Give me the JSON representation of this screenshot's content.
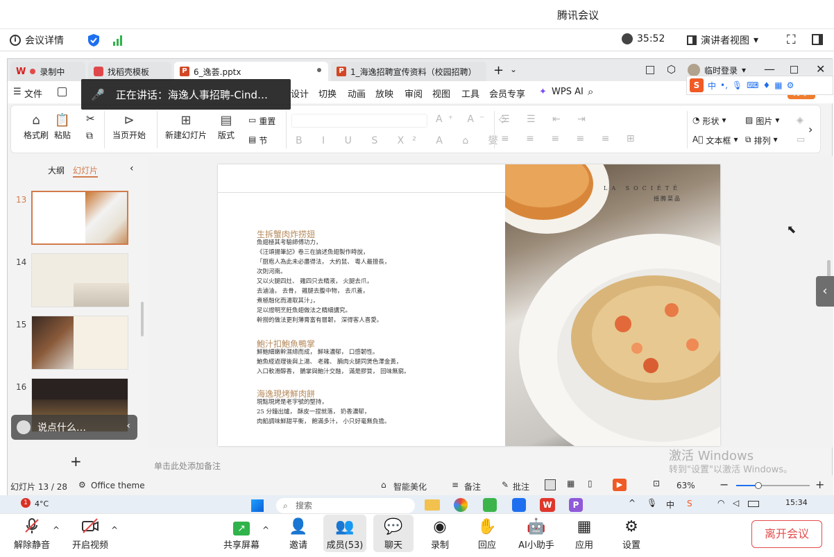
{
  "meeting": {
    "title": "腾讯会议",
    "details_label": "会议详情",
    "timer": "35:52",
    "view_label": "演讲者视图"
  },
  "wps": {
    "tabs": [
      {
        "label": "录制中"
      },
      {
        "label": "找稻壳模板"
      },
      {
        "label": "6_逸荟.pptx"
      },
      {
        "label": "1_海逸招聘宣传资料（校园招聘）.pp"
      }
    ],
    "login_label": "临时登录",
    "menu": [
      "文件",
      "设计",
      "切换",
      "动画",
      "放映",
      "审阅",
      "视图",
      "工具",
      "会员专享",
      "WPS AI"
    ],
    "share_label": "分享",
    "ribbon": {
      "format_brush": "格式刷",
      "paste": "粘贴",
      "from_current": "当页开始",
      "new_slide": "新建幻灯片",
      "layout": "版式",
      "reset": "重置",
      "section": "节",
      "shape": "形状",
      "picture": "图片",
      "textbox": "文本框",
      "arrange": "排列"
    },
    "pane_tabs": {
      "outline": "大纲",
      "slides": "幻灯片"
    },
    "slide_numbers": [
      "13",
      "14",
      "15",
      "16"
    ],
    "notes_placeholder": "单击此处添加备注",
    "status": {
      "slide_count": "幻灯片 13 / 28",
      "theme": "Office theme",
      "beautify": "智能美化",
      "notes": "备注",
      "comments": "批注",
      "zoom": "63%"
    }
  },
  "slide": {
    "brand": "LA SOCIÉTÉ",
    "brand_sub": "摇腾菜品",
    "section1_title": "生拆蟹肉炸捞翅",
    "section1_lines": [
      "魚翅極其考驗師傅功力，",
      "《汪頌揚筆記》卷三在論述魚翅製作時說，",
      "「厨庖人為此未必盡得法， 大約鼠、 粵人最擅長，",
      "次則河南。",
      "又以火腿四灶、 雞四只去精液， 火腿去爪，",
      "去滷油， 去骨， 雞腿去腹中物， 去爪蓋，",
      "煮極融化而湯取其汁」，",
      "足以證明烹飪魚翅做法之精細講究。",
      "幹撈的做法更利薄膏富有層韌， 深得客人喜愛。"
    ],
    "section2_title": "鮑汁扣鮑魚鴨掌",
    "section2_lines": [
      "鮮鮑細嫩幹濕總而成， 鮮味濃郁， 口感韌性。",
      "鮑魚經過理後與上湯、 老雞、 腩肉火腿同煲色澤金黃，",
      "入口軟滑醇香， 鵝掌與鮑汁交融， 滿是膠質， 回味無窮。"
    ],
    "section3_title": "海逸現烤鮮肉餅",
    "section3_lines": [
      "現點現烤是老字號的堅持，",
      "25 分鐘出爐， 酥皮一捏就落， 奶香濃郁，",
      "肉餡調味鮮甜平衡， 飽滿多汁， 小只好毫無負擔。"
    ]
  },
  "overlays": {
    "speaking": "正在讲话：海逸人事招聘-Cind…",
    "chat_placeholder": "说点什么…",
    "watermark_title": "激活 Windows",
    "watermark_sub": "转到\"设置\"以激活 Windows。"
  },
  "taskbar": {
    "weather": "4°C",
    "search": "搜索",
    "clock": "15:34"
  },
  "toolbar": {
    "unmute": "解除静音",
    "start_video": "开启视频",
    "share_screen": "共享屏幕",
    "invite": "邀请",
    "members": "成员(53)",
    "chat": "聊天",
    "record": "录制",
    "react": "回应",
    "ai": "AI小助手",
    "apps": "应用",
    "settings": "设置",
    "leave": "离开会议"
  },
  "colors": {
    "accent_orange": "#d27a4b",
    "leave_red": "#e34b4b",
    "shield_blue": "#1e6ff0",
    "signal_green": "#2fb34a"
  }
}
